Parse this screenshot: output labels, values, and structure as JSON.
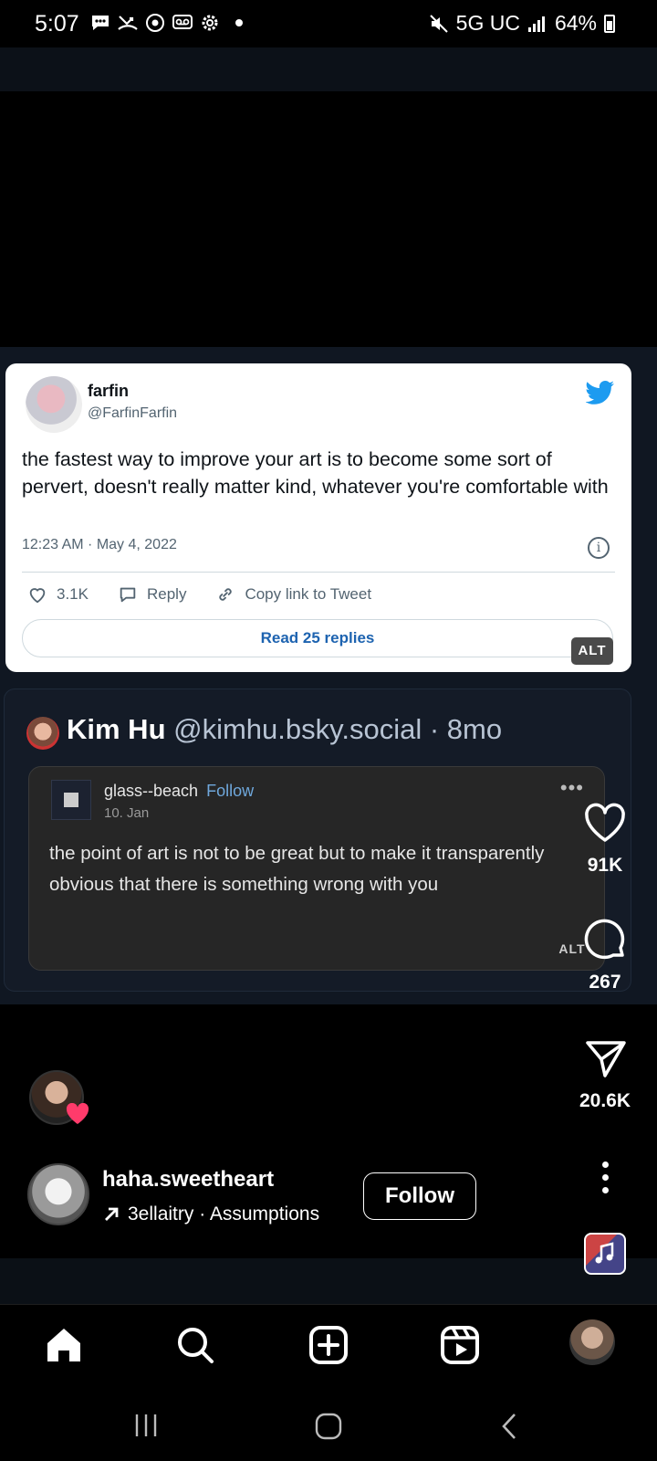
{
  "status_bar": {
    "time": "5:07",
    "network": "5G UC",
    "battery": "64%"
  },
  "tweet": {
    "name": "farfin",
    "handle": "@FarfinFarfin",
    "text": "the fastest way to improve your art is to become some sort of pervert, doesn't really matter kind, whatever you're comfortable with",
    "timestamp": "12:23 AM · May 4, 2022",
    "likes": "3.1K",
    "reply_label": "Reply",
    "copy_label": "Copy link to Tweet",
    "read_replies": "Read 25 replies",
    "alt": "ALT"
  },
  "bsky_post": {
    "name": "Kim Hu",
    "handle_time": "@kimhu.bsky.social · 8mo",
    "inner": {
      "name": "glass--beach",
      "follow": "Follow",
      "date": "10. Jan",
      "text": "the point of art is not to be great but to make it transparently obvious that there is something wrong with you",
      "alt": "ALT"
    }
  },
  "rail": {
    "likes": "91K",
    "comments": "267",
    "shares": "20.6K"
  },
  "user": {
    "username": "haha.sweetheart",
    "song": "3ellaitry · Assumptions",
    "follow_label": "Follow"
  },
  "nav": {
    "items": [
      "home-icon",
      "search-icon",
      "create-icon",
      "reels-icon",
      "profile-avatar"
    ]
  },
  "colors": {
    "link_blue": "#1d9bf0",
    "heart": "#ff3b6b"
  }
}
